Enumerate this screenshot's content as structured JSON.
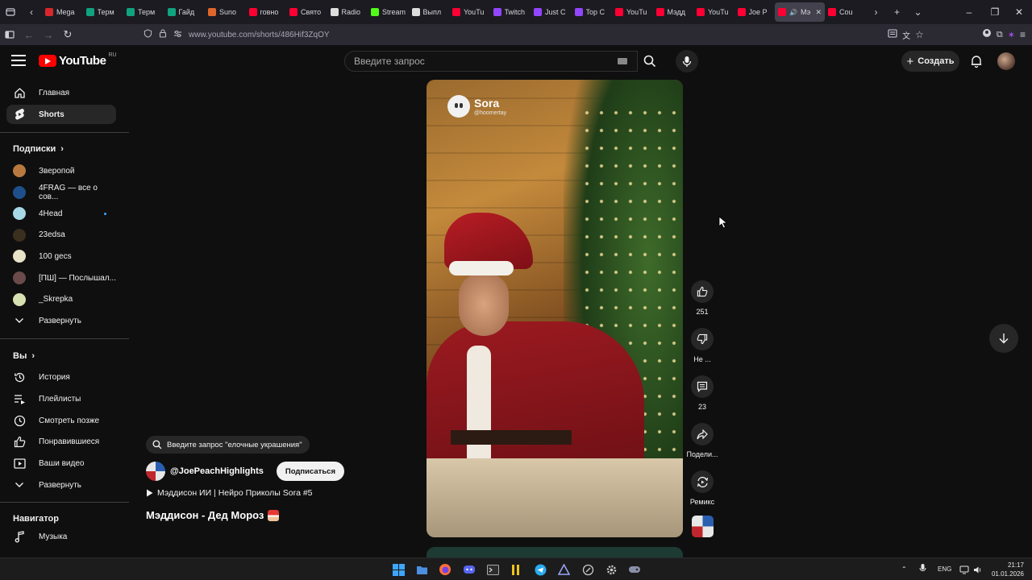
{
  "browser": {
    "tabs": [
      {
        "title": "Mega",
        "icon": "mega-favicon",
        "color": "#d9272e"
      },
      {
        "title": "Терм",
        "icon": "chatgpt-favicon",
        "color": "#10a37f"
      },
      {
        "title": "Терм",
        "icon": "chatgpt-favicon",
        "color": "#10a37f"
      },
      {
        "title": "Гайд",
        "icon": "chatgpt-favicon",
        "color": "#10a37f"
      },
      {
        "title": "Suno",
        "icon": "suno-favicon",
        "color": "#e0662a"
      },
      {
        "title": "говно",
        "icon": "youtube-favicon",
        "color": "#ff0033"
      },
      {
        "title": "Свято",
        "icon": "youtube-favicon",
        "color": "#ff0033"
      },
      {
        "title": "Radio",
        "icon": "radio-favicon",
        "color": "#dddddd"
      },
      {
        "title": "Stream",
        "icon": "kick-favicon",
        "color": "#53fc18"
      },
      {
        "title": "Выпл",
        "icon": "x-favicon",
        "color": "#dddddd"
      },
      {
        "title": "YouTu",
        "icon": "youtube-favicon",
        "color": "#ff0033"
      },
      {
        "title": "Twitch",
        "icon": "twitch-favicon",
        "color": "#9146ff"
      },
      {
        "title": "Just C",
        "icon": "twitch-favicon",
        "color": "#9146ff"
      },
      {
        "title": "Top C",
        "icon": "twitch-favicon",
        "color": "#9146ff"
      },
      {
        "title": "YouTu",
        "icon": "youtube-favicon",
        "color": "#ff0033"
      },
      {
        "title": "Мэдд",
        "icon": "youtube-favicon",
        "color": "#ff0033"
      },
      {
        "title": "YouTu",
        "icon": "youtube-favicon",
        "color": "#ff0033"
      },
      {
        "title": "Joe P",
        "icon": "youtube-favicon",
        "color": "#ff0033"
      },
      {
        "title": "Мэ",
        "icon": "youtube-favicon",
        "color": "#ff0033",
        "active": true
      },
      {
        "title": "Cou",
        "icon": "youtube-favicon",
        "color": "#ff0033"
      }
    ],
    "url": "www.youtube.com/shorts/486Hif3ZqOY"
  },
  "header": {
    "logo": "YouTube",
    "country": "RU",
    "search_placeholder": "Введите запрос",
    "create_label": "Создать"
  },
  "sidebar": {
    "home": "Главная",
    "shorts": "Shorts",
    "subscriptions_title": "Подписки",
    "subscriptions": [
      {
        "label": "Зверопой",
        "color": "#b7793f"
      },
      {
        "label": "4FRAG — все о сов...",
        "color": "#1e4f8a"
      },
      {
        "label": "4Head",
        "color": "#a6d8e6",
        "new": true
      },
      {
        "label": "23edsa",
        "color": "#3b2f1f"
      },
      {
        "label": "100 gecs",
        "color": "#e8e2c8"
      },
      {
        "label": "[ПШ] — Послышал...",
        "color": "#6b4a4a"
      },
      {
        "label": "_Skrepka",
        "color": "#d7e0b0"
      }
    ],
    "expand": "Развернуть",
    "you_title": "Вы",
    "you_items": [
      "История",
      "Плейлисты",
      "Смотреть позже",
      "Понравившиеся",
      "Ваши видео"
    ],
    "expand2": "Развернуть",
    "navigator_title": "Навигатор",
    "music": "Музыка"
  },
  "short": {
    "suggest": "Введите запрос \"елочные украшения\"",
    "channel": "@JoePeachHighlights",
    "subscribe": "Подписаться",
    "playlist": "Мэддисон ИИ | Нейро Приколы Sora #5",
    "title": "Мэддисон - Дед Мороз",
    "sora_name": "Sora",
    "sora_handle": "@hoomertay"
  },
  "actions": {
    "likes": "251",
    "dislike": "Не ...",
    "comments": "23",
    "share": "Подели...",
    "remix": "Ремикс"
  },
  "taskbar": {
    "lang": "ENG",
    "time": "21:17",
    "date": "01.01.2026"
  }
}
